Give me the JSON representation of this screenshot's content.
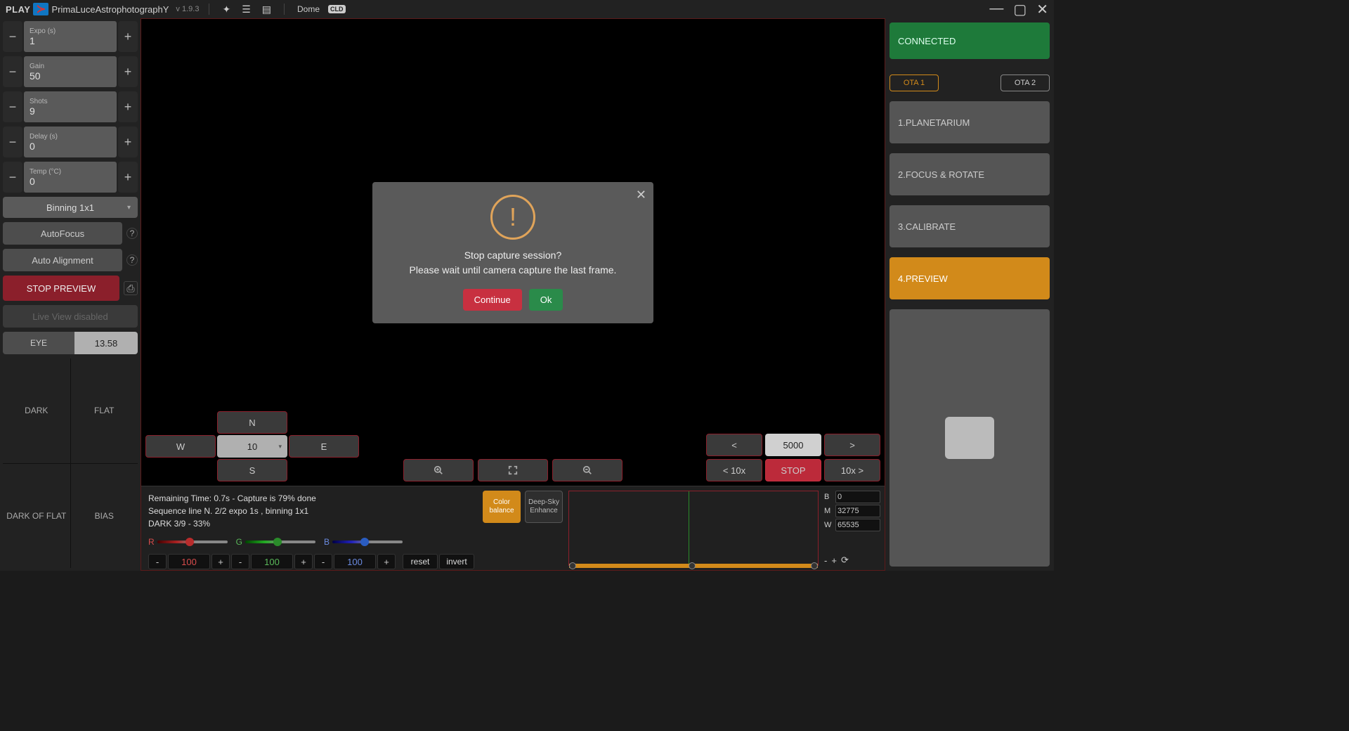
{
  "header": {
    "play": "PLAY",
    "brand_glyph": "≻",
    "subtitle": "PrimaLuceAstrophotographY",
    "version": "v 1.9.3",
    "dome_label": "Dome",
    "dome_badge": "CLD"
  },
  "left": {
    "expo": {
      "label": "Expo (s)",
      "value": "1"
    },
    "gain": {
      "label": "Gain",
      "value": "50"
    },
    "shots": {
      "label": "Shots",
      "value": "9"
    },
    "delay": {
      "label": "Delay (s)",
      "value": "0"
    },
    "temp": {
      "label": "Temp (°C)",
      "value": "0"
    },
    "binning": "Binning 1x1",
    "autofocus": "AutoFocus",
    "autoalign": "Auto Alignment",
    "stop_preview": "STOP PREVIEW",
    "liveview": "Live View disabled",
    "eye": {
      "label": "EYE",
      "value": "13.58"
    },
    "frames": {
      "dark": "DARK",
      "flat": "FLAT",
      "darkflat": "DARK OF FLAT",
      "bias": "BIAS"
    }
  },
  "center": {
    "dir": {
      "n": "N",
      "s": "S",
      "e": "E",
      "w": "W",
      "speed": "10"
    },
    "focus": {
      "left": "<",
      "right": ">",
      "value": "5000",
      "left10": "< 10x",
      "right10": "10x >",
      "stop": "STOP"
    }
  },
  "bottom": {
    "line1": "Remaining Time: 0.7s  -  Capture is 79% done",
    "line2": "Sequence line N. 2/2 expo 1s , binning 1x1",
    "line3": "DARK 3/9 - 33%",
    "rgb": {
      "r_label": "R",
      "g_label": "G",
      "b_label": "B",
      "r_val": "100",
      "g_val": "100",
      "b_val": "100"
    },
    "reset": "reset",
    "invert": "invert",
    "color_balance": "Color balance",
    "deepsky": "Deep-Sky Enhance",
    "levels": {
      "b_label": "B",
      "b_val": "0",
      "m_label": "M",
      "m_val": "32775",
      "w_label": "W",
      "w_val": "65535"
    }
  },
  "right": {
    "connected": "CONNECTED",
    "ota1": "OTA 1",
    "ota2": "OTA 2",
    "stage1": "1.PLANETARIUM",
    "stage2": "2.FOCUS & ROTATE",
    "stage3": "3.CALIBRATE",
    "stage4": "4.PREVIEW"
  },
  "modal": {
    "line1": "Stop capture session?",
    "line2": "Please wait until camera capture the last frame.",
    "continue": "Continue",
    "ok": "Ok"
  }
}
